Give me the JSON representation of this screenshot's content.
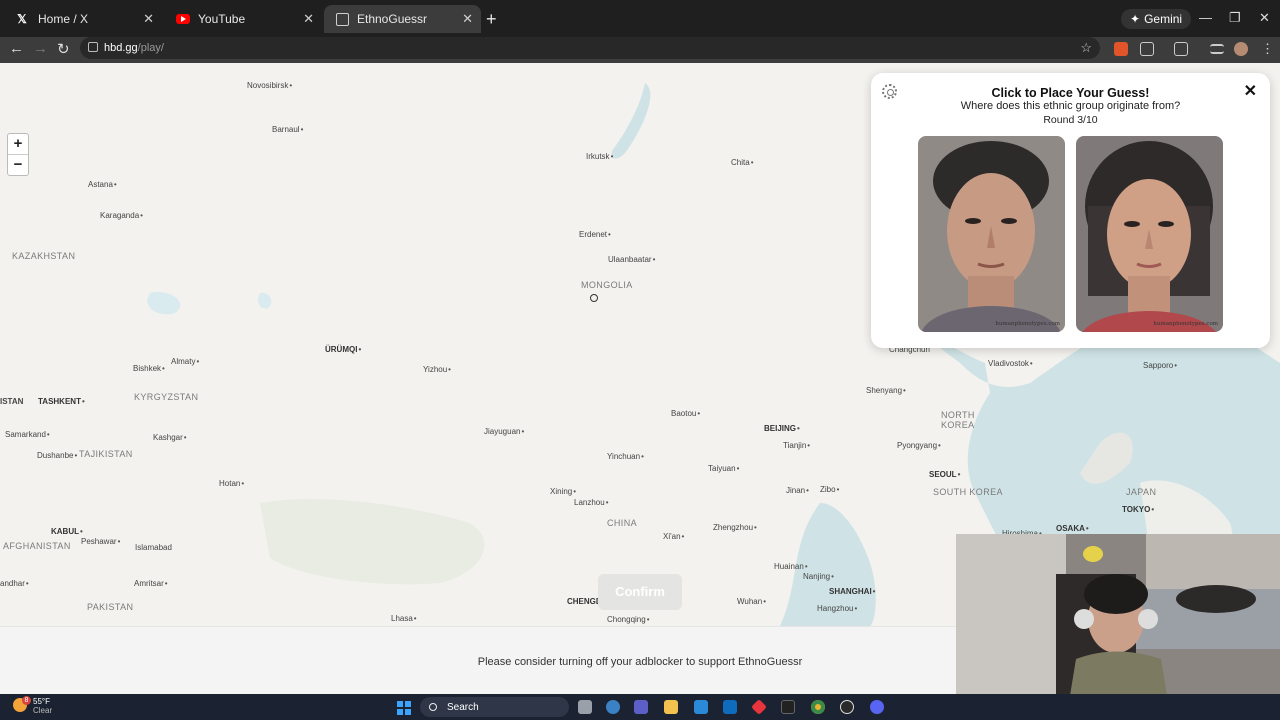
{
  "browser": {
    "tabs": [
      {
        "label": "Home / X",
        "favicon": "x-icon"
      },
      {
        "label": "YouTube",
        "favicon": "youtube-icon"
      },
      {
        "label": "EthnoGuessr",
        "favicon": "ethnoguessr-icon",
        "active": true
      }
    ],
    "gemini_label": "Gemini",
    "url_host": "hbd.gg",
    "url_path": "/play/"
  },
  "map": {
    "zoom_in": "+",
    "zoom_out": "−",
    "labels": {
      "novosibirsk": "Novosibirsk",
      "barnaul": "Barnaul",
      "irkutsk": "Irkutsk",
      "chita": "Chita",
      "astana": "Astana",
      "karaganda": "Karaganda",
      "kazakhstan": "KAZAKHSTAN",
      "erdenet": "Erdenet",
      "ulaanbaatar": "Ulaanbaatar",
      "mongolia": "MONGOLIA",
      "urumqi": "ÜRÜMQI",
      "almaty": "Almaty",
      "bishkek": "Bishkek",
      "yizhou": "Yizhou",
      "tashkent": "TASHKENT",
      "istan": "ISTAN",
      "kyrgyzstan": "KYRGYZSTAN",
      "samarkand": "Samarkand",
      "kashgar": "Kashgar",
      "dushanbe": "Dushanbe",
      "tajikistan": "TAJIKISTAN",
      "hotan": "Hotan",
      "jiayuguan": "Jiayuguan",
      "baotou": "Baotou",
      "beijing": "BEIJING",
      "tianjin": "Tianjin",
      "yinchuan": "Yinchuan",
      "taiyuan": "Taiyuan",
      "xining": "Xining",
      "lanzhou": "Lanzhou",
      "china": "CHINA",
      "jinan": "Jinan",
      "zibo": "Zibo",
      "zhengzhou": "Zhengzhou",
      "xian": "Xi'an",
      "kabul": "KABUL",
      "afghanistan": "AFGHANISTAN",
      "peshawar": "Peshawar",
      "islamabad": "Islamabad",
      "amritsar": "Amritsar",
      "andhar": "andhar",
      "pakistan": "PAKISTAN",
      "lhasa": "Lhasa",
      "chengdu": "CHENGDU",
      "chongqing": "Chongqing",
      "wuhan": "Wuhan",
      "huainan": "Huainan",
      "nanjing": "Nanjing",
      "shanghai": "SHANGHAI",
      "hangzhou": "Hangzhou",
      "shenyang": "Shenyang",
      "changchun": "Changchun",
      "vladivostok": "Vladivostok",
      "sapporo": "Sapporo",
      "north_korea": "NORTH KOREA",
      "pyongyang": "Pyongyang",
      "seoul": "SEOUL",
      "south_korea": "SOUTH KOREA",
      "japan": "JAPAN",
      "tokyo": "TOKYO",
      "osaka": "OSAKA",
      "hiroshima": "Hiroshima"
    }
  },
  "panel": {
    "title": "Click to Place Your Guess!",
    "subtitle": "Where does this ethnic group originate from?",
    "round": "Round 3/10",
    "close_label": "✕",
    "faces": [
      {
        "alt": "male average face",
        "watermark": "humanphenotypes.com"
      },
      {
        "alt": "female average face",
        "watermark": "humanphenotypes.com"
      }
    ]
  },
  "confirm_label": "Confirm",
  "adblock_notice": "Please consider turning off your adblocker to support EthnoGuessr",
  "taskbar": {
    "temperature": "55°F",
    "condition": "Clear",
    "weather_badge": "8",
    "search_label": "Search"
  },
  "colors": {
    "water": "#cfe3e6",
    "land": "#f3f2ee",
    "browser_dark": "#1f1f1f",
    "taskbar": "#1b2332"
  }
}
